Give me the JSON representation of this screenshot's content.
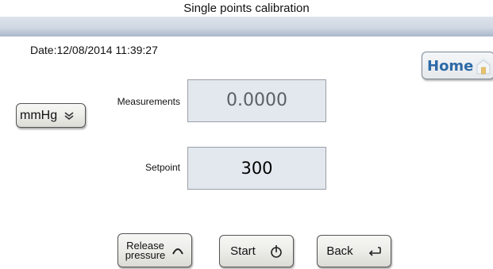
{
  "header": {
    "title": "Single points calibration"
  },
  "status": {
    "date_text": "Date:12/08/2014  11:39:27"
  },
  "nav": {
    "home_label": "Home"
  },
  "unit_selector": {
    "selected": "mmHg"
  },
  "measurements": {
    "label": "Measurements",
    "value": "0.0000"
  },
  "setpoint": {
    "label": "Setpoint",
    "value": "300"
  },
  "buttons": {
    "release_line1": "Release",
    "release_line2": "pressure",
    "start": "Start",
    "back": "Back"
  },
  "icons": {
    "home": "house-icon",
    "unit_dropdown": "double-chevron-down-icon",
    "release": "arc-icon",
    "start": "power-icon",
    "back": "return-arrow-icon"
  },
  "colors": {
    "title_bar": "#d0d8e3",
    "value_box": "#e3e8ee",
    "home_text": "#2e6aa6"
  }
}
